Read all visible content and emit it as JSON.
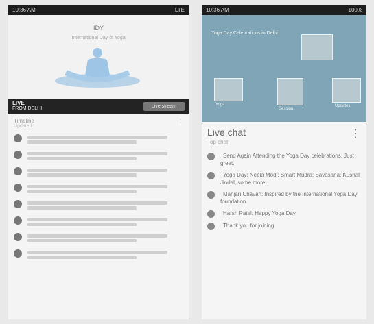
{
  "left": {
    "status": {
      "left": "10:36 AM",
      "right": "LTE"
    },
    "banner": {
      "logo": "IDY",
      "subtitle": "International Day of Yoga"
    },
    "live_strip": {
      "title": "LIVE",
      "subtitle": "FROM DELHI",
      "button": "Live stream"
    },
    "meta": {
      "title": "Timeline",
      "sub": "Updated"
    },
    "feed_count": 8
  },
  "right": {
    "status": {
      "left": "10:36 AM",
      "right": "100%"
    },
    "top": {
      "title": "Yoga Day Celebrations in Delhi"
    },
    "thumb_caps": [
      "Yoga",
      "Session",
      "Updates"
    ],
    "live_header": {
      "title": "Live chat",
      "sub": "Top chat"
    },
    "chat": [
      {
        "from": "",
        "text": "Send Again Attending the Yoga Day celebrations. Just great."
      },
      {
        "from": "",
        "text": "Yoga Day: Neela Modi; Smart Mudra; Savasana; Kushal Jindal, some more."
      },
      {
        "from": "",
        "text": "Manjari Chavan: Inspired by the International Yoga Day foundation."
      },
      {
        "from": "",
        "text": "Harsh Patel: Happy Yoga Day"
      },
      {
        "from": "",
        "text": "Thank you for joining"
      }
    ]
  }
}
